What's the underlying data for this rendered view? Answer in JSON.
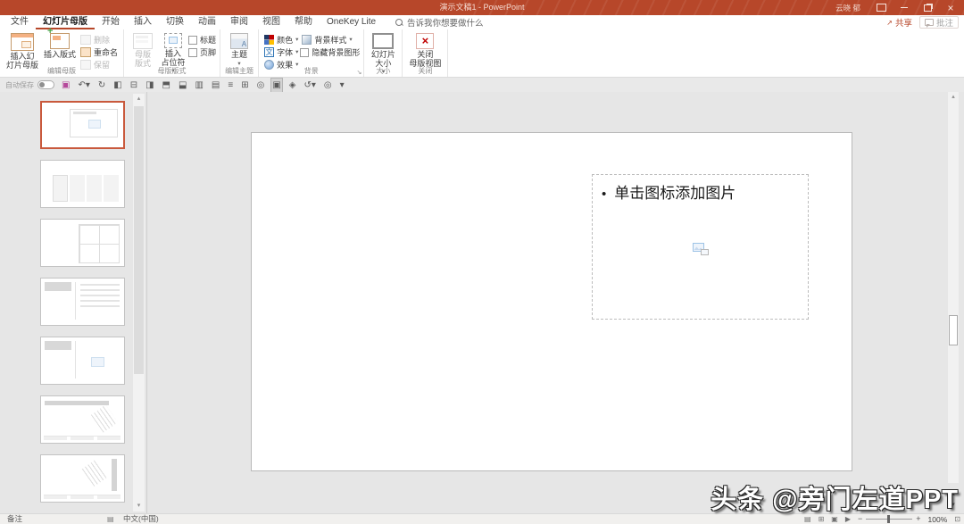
{
  "icons": {
    "dropdown": "▾",
    "up": "▴",
    "down": "▾",
    "minus": "−",
    "plus": "+"
  },
  "title_bar": {
    "title": "演示文稿1 - PowerPoint",
    "user_name": "云晓 郁"
  },
  "tab_row": {
    "tabs": [
      {
        "name": "tab-file",
        "label": "文件"
      },
      {
        "name": "tab-slide-master",
        "label": "幻灯片母版",
        "class": "active"
      },
      {
        "name": "tab-home",
        "label": "开始"
      },
      {
        "name": "tab-insert",
        "label": "插入"
      },
      {
        "name": "tab-transitions",
        "label": "切换"
      },
      {
        "name": "tab-animations",
        "label": "动画"
      },
      {
        "name": "tab-review",
        "label": "审阅"
      },
      {
        "name": "tab-view",
        "label": "视图"
      },
      {
        "name": "tab-help",
        "label": "帮助"
      },
      {
        "name": "tab-onekey-lite",
        "label": "OneKey Lite"
      }
    ],
    "search_placeholder": "告诉我你想要做什么",
    "share_label": "共享",
    "comments_label": "批注"
  },
  "ribbon": {
    "edit_master": {
      "label": "编辑母版",
      "insert_slide_master": "插入幻\n灯片母版",
      "insert_layout": "插入版式",
      "delete": "删除",
      "rename": "重命名",
      "preserve": "保留"
    },
    "master_layout": {
      "label": "母版版式",
      "master_layout_btn": "母版\n版式",
      "insert_placeholder": "插入\n占位符",
      "title_cb": "标题",
      "footer_cb": "页脚"
    },
    "edit_theme": {
      "label": "编辑主题",
      "themes": "主题"
    },
    "background": {
      "label": "背景",
      "colors": "颜色",
      "fonts": "字体",
      "effects": "效果",
      "background_styles": "背景样式",
      "hide_bg": "隐藏背景图形"
    },
    "size": {
      "label": "大小",
      "slide_size": "幻灯片\n大小"
    },
    "close": {
      "label": "关闭",
      "close_master_view": "关闭\n母版视图"
    }
  },
  "qat": {
    "autosave_label": "自动保存",
    "icons": [
      {
        "name": "save-icon",
        "glyph": "▣",
        "class": "magenta"
      },
      {
        "name": "undo-icon",
        "glyph": "↶▾"
      },
      {
        "name": "redo-icon",
        "glyph": "↻"
      },
      {
        "name": "align-left-icon",
        "glyph": "◧"
      },
      {
        "name": "align-center-icon",
        "glyph": "⊟"
      },
      {
        "name": "align-right-icon",
        "glyph": "◨"
      },
      {
        "name": "align-top-icon",
        "glyph": "⬒"
      },
      {
        "name": "align-bottom-icon",
        "glyph": "⬓"
      },
      {
        "name": "distribute-horizontal-icon",
        "glyph": "▥"
      },
      {
        "name": "distribute-vertical-icon",
        "glyph": "▤"
      },
      {
        "name": "align-middle-icon",
        "glyph": "≡"
      },
      {
        "name": "group-objects-icon",
        "glyph": "⊞"
      },
      {
        "name": "gridlines-icon",
        "glyph": "◎"
      },
      {
        "name": "insert-placeholder-icon",
        "glyph": "▣",
        "class": "selected"
      },
      {
        "name": "shape-effects-icon",
        "glyph": "◈"
      },
      {
        "name": "rotate-icon",
        "glyph": "↺▾"
      },
      {
        "name": "preview-icon",
        "glyph": "◎"
      },
      {
        "name": "more-commands-icon",
        "glyph": "▾"
      }
    ]
  },
  "thumbnails": [
    {
      "name": "slide-thumbnail-1",
      "class": "t1 selected"
    },
    {
      "name": "slide-thumbnail-2",
      "class": "t2"
    },
    {
      "name": "slide-thumbnail-3",
      "class": "t3"
    },
    {
      "name": "slide-thumbnail-4",
      "class": "t4"
    },
    {
      "name": "slide-thumbnail-5",
      "class": "t5"
    },
    {
      "name": "slide-thumbnail-6",
      "class": "t6"
    },
    {
      "name": "slide-thumbnail-7",
      "class": "t7"
    }
  ],
  "slide": {
    "placeholder_bullet": "•",
    "placeholder_text": "单击图标添加图片"
  },
  "status_bar": {
    "notes": "备注",
    "language": "中文(中国)",
    "zoom_level": "100%"
  },
  "watermark": "头条 @旁门左道PPT"
}
